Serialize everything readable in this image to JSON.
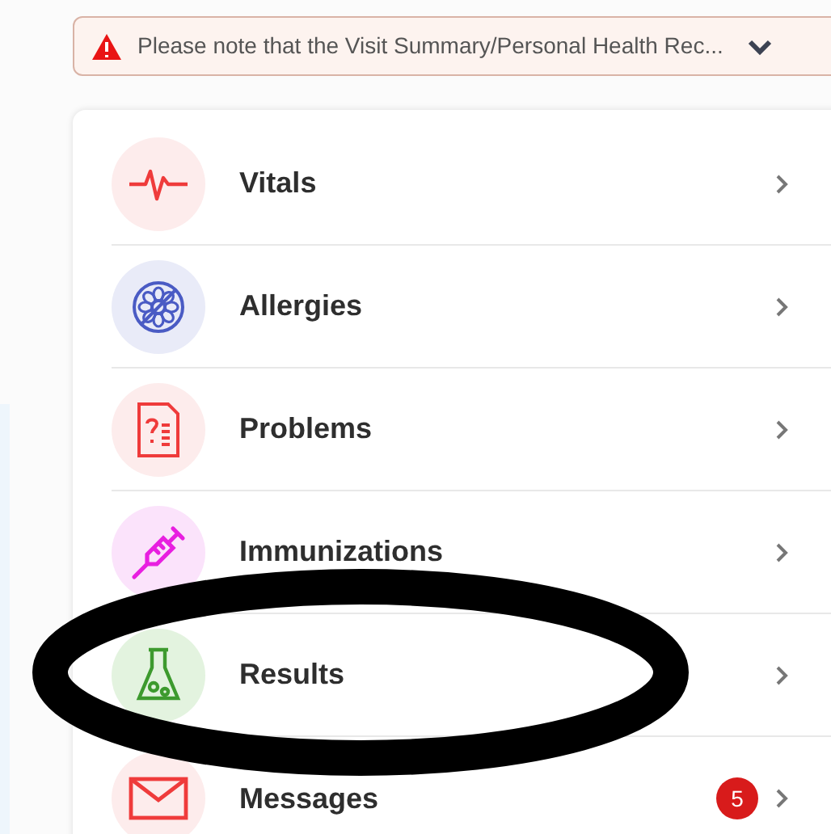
{
  "notice": {
    "text": "Please note that the Visit Summary/Personal Health Rec...",
    "expanded": false
  },
  "menu": [
    {
      "kind": "vitals",
      "label": "Vitals"
    },
    {
      "kind": "allergies",
      "label": "Allergies"
    },
    {
      "kind": "problems",
      "label": "Problems"
    },
    {
      "kind": "immunizations",
      "label": "Immunizations"
    },
    {
      "kind": "results",
      "label": "Results"
    },
    {
      "kind": "messages",
      "label": "Messages",
      "badge": "5"
    }
  ]
}
